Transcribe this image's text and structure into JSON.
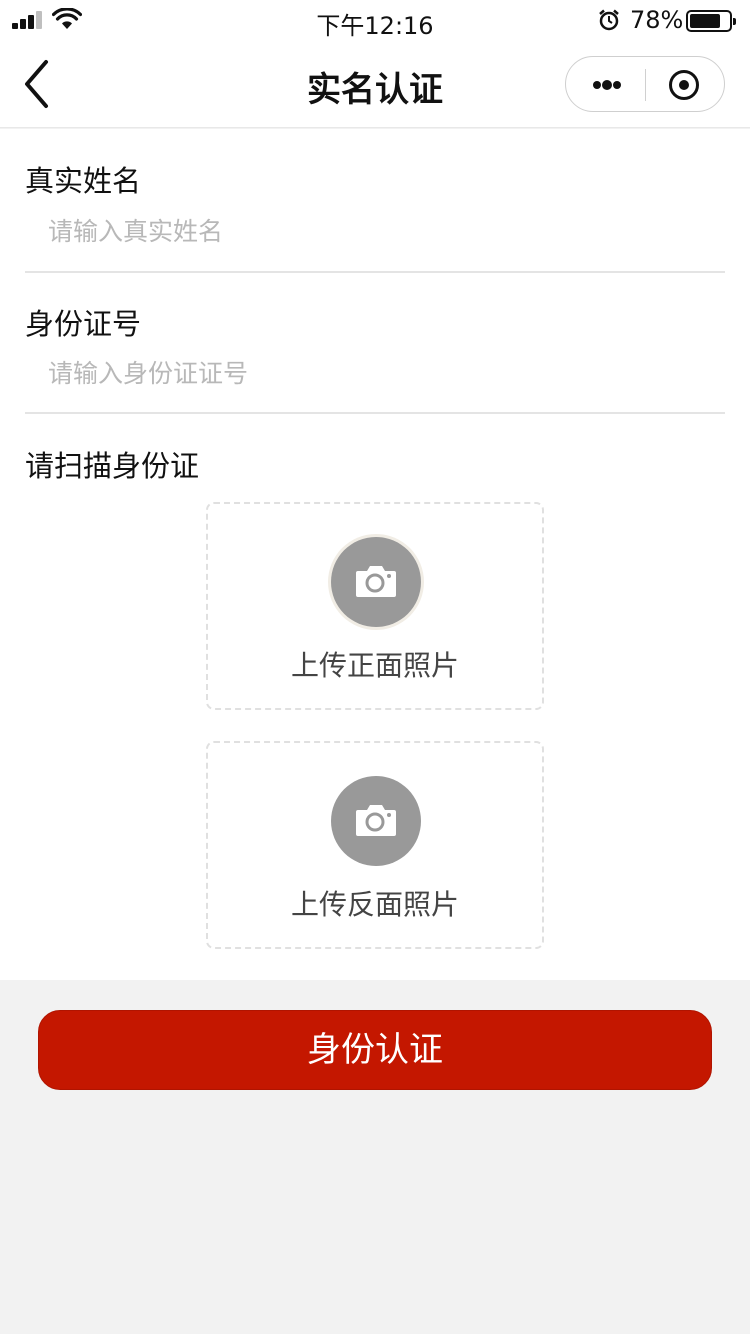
{
  "status_bar": {
    "time": "下午12:16",
    "battery_percent": "78%",
    "battery_level": 0.78,
    "icons": [
      "signal-icon",
      "wifi-icon",
      "alarm-icon",
      "battery-icon"
    ]
  },
  "nav": {
    "title": "实名认证",
    "back_icon": "chevron-left-icon",
    "more_icon": "more-dots-icon",
    "close_icon": "target-circle-icon"
  },
  "form": {
    "name_label": "真实姓名",
    "name_placeholder": "请输入真实姓名",
    "name_value": "",
    "id_label": "身份证号",
    "id_placeholder": "请输入身份证证号",
    "id_value": "",
    "scan_label": "请扫描身份证",
    "upload_front_label": "上传正面照片",
    "upload_back_label": "上传反面照片",
    "camera_icon": "camera-icon"
  },
  "submit": {
    "label": "身份认证",
    "color": "#c41700"
  }
}
